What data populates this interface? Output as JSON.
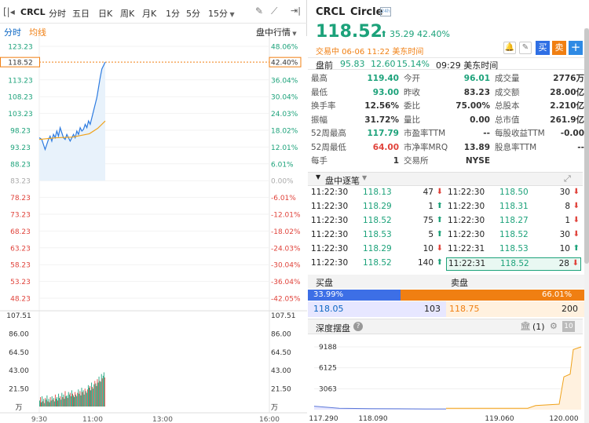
{
  "toolbar": {
    "ticker": "CRCL",
    "tabs": [
      "分时",
      "五日",
      "日K",
      "周K",
      "月K",
      "1分",
      "5分",
      "15分"
    ],
    "active_tab": "分时"
  },
  "subbar": {
    "mode": "分时",
    "avg": "均线",
    "session": "盘中行情"
  },
  "chart_data": {
    "type": "line",
    "price_ticks": [
      "123.23",
      "118.52",
      "113.23",
      "108.23",
      "103.23",
      "98.23",
      "93.23",
      "88.23",
      "83.23",
      "78.23",
      "73.23",
      "68.23",
      "63.23",
      "58.23",
      "53.23",
      "48.23"
    ],
    "pct_ticks": [
      "48.06%",
      "42.40%",
      "36.04%",
      "30.04%",
      "24.03%",
      "18.02%",
      "12.01%",
      "6.01%",
      "0.00%",
      "-6.01%",
      "-12.01%",
      "-18.02%",
      "-24.03%",
      "-30.04%",
      "-36.04%",
      "-42.05%"
    ],
    "price_series": [
      [
        0,
        96.0
      ],
      [
        3,
        95.5
      ],
      [
        5,
        94.0
      ],
      [
        7,
        92.5
      ],
      [
        9,
        94.0
      ],
      [
        11,
        95.5
      ],
      [
        13,
        96.5
      ],
      [
        15,
        95.0
      ],
      [
        17,
        97.0
      ],
      [
        19,
        96.0
      ],
      [
        21,
        98.0
      ],
      [
        23,
        96.5
      ],
      [
        25,
        99.0
      ],
      [
        27,
        97.5
      ],
      [
        29,
        96.0
      ],
      [
        31,
        95.5
      ],
      [
        33,
        97.0
      ],
      [
        35,
        96.0
      ],
      [
        37,
        95.0
      ],
      [
        39,
        96.0
      ],
      [
        41,
        97.0
      ],
      [
        43,
        96.0
      ],
      [
        45,
        98.0
      ],
      [
        47,
        97.0
      ],
      [
        49,
        99.0
      ],
      [
        51,
        98.0
      ],
      [
        53,
        98.5
      ],
      [
        55,
        100.0
      ],
      [
        57,
        99.0
      ],
      [
        59,
        101.0
      ],
      [
        61,
        100.0
      ],
      [
        63,
        102.0
      ],
      [
        65,
        104.0
      ],
      [
        67,
        106.0
      ],
      [
        69,
        108.0
      ],
      [
        71,
        111.0
      ],
      [
        73,
        114.0
      ],
      [
        75,
        116.5
      ],
      [
        77,
        117.5
      ],
      [
        79,
        118.52
      ]
    ],
    "avg_series": [
      [
        0,
        95.5
      ],
      [
        20,
        96.0
      ],
      [
        40,
        96.2
      ],
      [
        60,
        97.2
      ],
      [
        70,
        98.8
      ],
      [
        79,
        101.0
      ]
    ],
    "last_price": 118.52,
    "prev_close": 83.23,
    "vol_ticks": [
      "107.51",
      "86.00",
      "64.50",
      "43.00",
      "21.50",
      "万"
    ],
    "time_labels": [
      "9:30",
      "11:00",
      "13:00",
      "16:00"
    ],
    "volumes": [
      7,
      11,
      5,
      12,
      6,
      9,
      4,
      10,
      8,
      13,
      6,
      9,
      5,
      11,
      7,
      12,
      8,
      10,
      6,
      14,
      9,
      11,
      7,
      15,
      10,
      12,
      8,
      16,
      11,
      14,
      9,
      18,
      12,
      13,
      10,
      17,
      14,
      16,
      12,
      19,
      15,
      13,
      11,
      17,
      14,
      12,
      16,
      20,
      15,
      18,
      13,
      22,
      17,
      19,
      14,
      21,
      18,
      16,
      20,
      25,
      22,
      24,
      19,
      28,
      23,
      21,
      26,
      30,
      27,
      24,
      32,
      28,
      35,
      30,
      29,
      38,
      33,
      36,
      40,
      34
    ]
  },
  "quote": {
    "ticker": "CRCL",
    "name": "Circle",
    "price": "118.52",
    "change": "35.29",
    "pct": "42.40%",
    "status": "交易中 06-06 11:22 美东时间",
    "pre_label": "盘前",
    "pre_price": "95.83",
    "pre_change": "12.60",
    "pre_pct": "15.14%",
    "pre_time": "09:29 美东时间",
    "buy": "买",
    "sell": "卖"
  },
  "stats": [
    [
      "最高",
      "119.40",
      "今开",
      "96.01",
      "成交量",
      "2776万"
    ],
    [
      "最低",
      "93.00",
      "昨收",
      "83.23",
      "成交额",
      "28.00亿"
    ],
    [
      "换手率",
      "12.56%",
      "委比",
      "75.00%",
      "总股本",
      "2.210亿"
    ],
    [
      "振幅",
      "31.72%",
      "量比",
      "0.00",
      "总市值",
      "261.9亿"
    ],
    [
      "52周最高",
      "117.79",
      "市盈率TTM",
      "--",
      "每股收益TTM",
      "-0.00"
    ],
    [
      "52周最低",
      "64.00",
      "市净率MRQ",
      "13.89",
      "股息率TTM",
      "--"
    ],
    [
      "每手",
      "1",
      "交易所",
      "NYSE",
      "",
      ""
    ]
  ],
  "ticks_title": "盘中逐笔",
  "ticks_left": [
    [
      "11:22:30",
      "118.13",
      "47",
      "d"
    ],
    [
      "11:22:30",
      "118.29",
      "1",
      "u"
    ],
    [
      "11:22:30",
      "118.52",
      "75",
      "u"
    ],
    [
      "11:22:30",
      "118.53",
      "5",
      "u"
    ],
    [
      "11:22:30",
      "118.29",
      "10",
      "d"
    ],
    [
      "11:22:30",
      "118.52",
      "140",
      "u"
    ]
  ],
  "ticks_right": [
    [
      "11:22:30",
      "118.50",
      "30",
      "d"
    ],
    [
      "11:22:30",
      "118.31",
      "8",
      "d"
    ],
    [
      "11:22:30",
      "118.27",
      "1",
      "d"
    ],
    [
      "11:22:30",
      "118.52",
      "30",
      "d"
    ],
    [
      "11:22:31",
      "118.53",
      "10",
      "u"
    ],
    [
      "11:22:31",
      "118.52",
      "28",
      "d"
    ]
  ],
  "book": {
    "bid_label": "买盘",
    "ask_label": "卖盘",
    "bid_pct": "33.99%",
    "ask_pct": "66.01%",
    "bid_price": "118.05",
    "bid_size": "103",
    "ask_price": "118.75",
    "ask_size": "200"
  },
  "depth": {
    "title": "深度摆盘",
    "count": "(1)",
    "level": "10",
    "y_ticks": [
      "9188",
      "6125",
      "3063"
    ],
    "x_ticks": [
      "117.290",
      "118.090",
      "119.060",
      "120.000"
    ]
  }
}
